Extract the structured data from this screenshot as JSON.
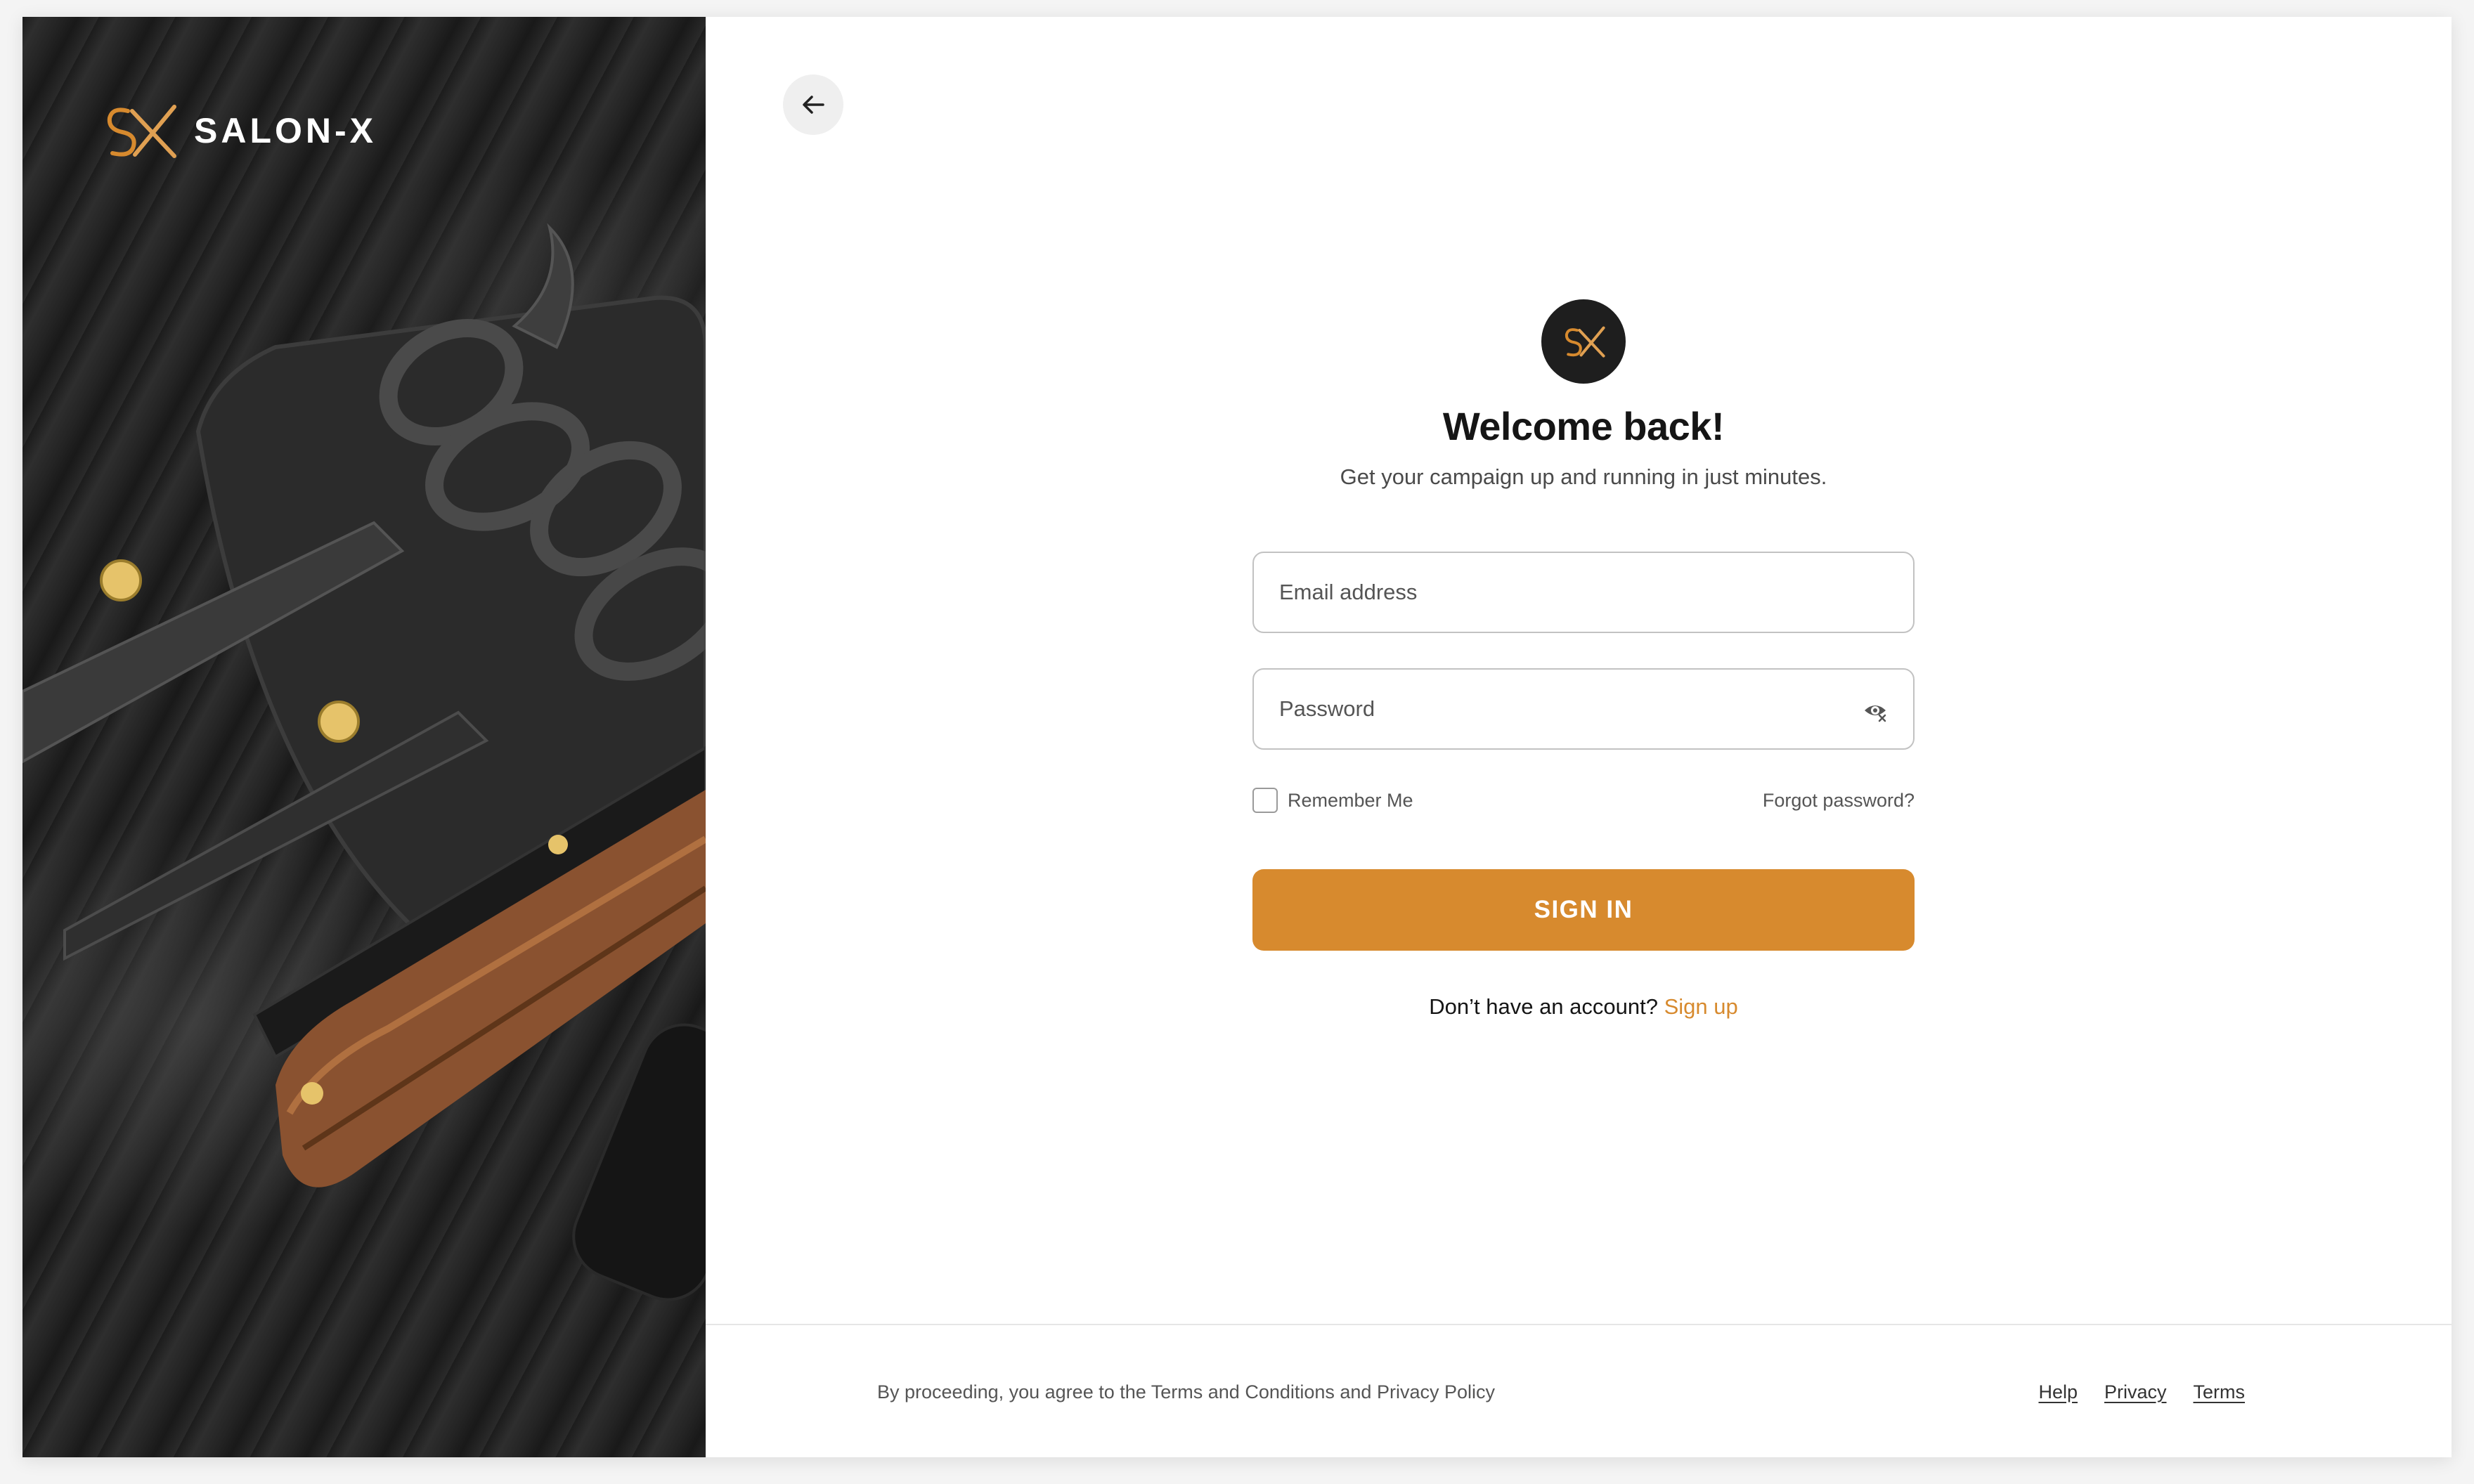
{
  "brand": {
    "name": "SALON-X",
    "accent_color": "#d78a2e"
  },
  "hero_image": {
    "icon": "barber-scissors-razor-photo"
  },
  "nav": {
    "back_icon": "arrow-left-icon"
  },
  "login": {
    "title": "Welcome back!",
    "subtitle": "Get your campaign up and running in just minutes.",
    "email_placeholder": "Email address",
    "email_value": "",
    "password_placeholder": "Password",
    "password_value": "",
    "password_toggle_icon": "eye-off-icon",
    "remember_label": "Remember Me",
    "remember_checked": false,
    "forgot_label": "Forgot password?",
    "signin_label": "SIGN IN",
    "signup_prompt": "Don’t have an account?",
    "signup_link": "Sign up"
  },
  "footer": {
    "disclaimer": "By proceeding, you agree to the Terms and Conditions and Privacy Policy",
    "links": [
      "Help",
      "Privacy",
      "Terms"
    ]
  }
}
